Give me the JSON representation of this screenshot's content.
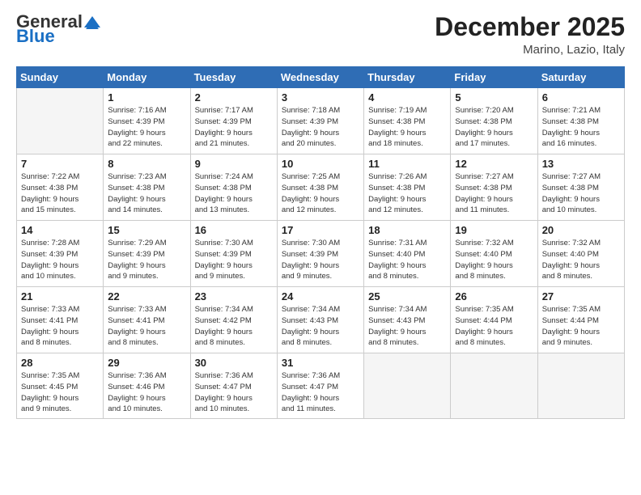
{
  "logo": {
    "general": "General",
    "blue": "Blue"
  },
  "header": {
    "month": "December 2025",
    "location": "Marino, Lazio, Italy"
  },
  "weekdays": [
    "Sunday",
    "Monday",
    "Tuesday",
    "Wednesday",
    "Thursday",
    "Friday",
    "Saturday"
  ],
  "weeks": [
    [
      {
        "day": "",
        "info": ""
      },
      {
        "day": "1",
        "info": "Sunrise: 7:16 AM\nSunset: 4:39 PM\nDaylight: 9 hours\nand 22 minutes."
      },
      {
        "day": "2",
        "info": "Sunrise: 7:17 AM\nSunset: 4:39 PM\nDaylight: 9 hours\nand 21 minutes."
      },
      {
        "day": "3",
        "info": "Sunrise: 7:18 AM\nSunset: 4:39 PM\nDaylight: 9 hours\nand 20 minutes."
      },
      {
        "day": "4",
        "info": "Sunrise: 7:19 AM\nSunset: 4:38 PM\nDaylight: 9 hours\nand 18 minutes."
      },
      {
        "day": "5",
        "info": "Sunrise: 7:20 AM\nSunset: 4:38 PM\nDaylight: 9 hours\nand 17 minutes."
      },
      {
        "day": "6",
        "info": "Sunrise: 7:21 AM\nSunset: 4:38 PM\nDaylight: 9 hours\nand 16 minutes."
      }
    ],
    [
      {
        "day": "7",
        "info": "Sunrise: 7:22 AM\nSunset: 4:38 PM\nDaylight: 9 hours\nand 15 minutes."
      },
      {
        "day": "8",
        "info": "Sunrise: 7:23 AM\nSunset: 4:38 PM\nDaylight: 9 hours\nand 14 minutes."
      },
      {
        "day": "9",
        "info": "Sunrise: 7:24 AM\nSunset: 4:38 PM\nDaylight: 9 hours\nand 13 minutes."
      },
      {
        "day": "10",
        "info": "Sunrise: 7:25 AM\nSunset: 4:38 PM\nDaylight: 9 hours\nand 12 minutes."
      },
      {
        "day": "11",
        "info": "Sunrise: 7:26 AM\nSunset: 4:38 PM\nDaylight: 9 hours\nand 12 minutes."
      },
      {
        "day": "12",
        "info": "Sunrise: 7:27 AM\nSunset: 4:38 PM\nDaylight: 9 hours\nand 11 minutes."
      },
      {
        "day": "13",
        "info": "Sunrise: 7:27 AM\nSunset: 4:38 PM\nDaylight: 9 hours\nand 10 minutes."
      }
    ],
    [
      {
        "day": "14",
        "info": "Sunrise: 7:28 AM\nSunset: 4:39 PM\nDaylight: 9 hours\nand 10 minutes."
      },
      {
        "day": "15",
        "info": "Sunrise: 7:29 AM\nSunset: 4:39 PM\nDaylight: 9 hours\nand 9 minutes."
      },
      {
        "day": "16",
        "info": "Sunrise: 7:30 AM\nSunset: 4:39 PM\nDaylight: 9 hours\nand 9 minutes."
      },
      {
        "day": "17",
        "info": "Sunrise: 7:30 AM\nSunset: 4:39 PM\nDaylight: 9 hours\nand 9 minutes."
      },
      {
        "day": "18",
        "info": "Sunrise: 7:31 AM\nSunset: 4:40 PM\nDaylight: 9 hours\nand 8 minutes."
      },
      {
        "day": "19",
        "info": "Sunrise: 7:32 AM\nSunset: 4:40 PM\nDaylight: 9 hours\nand 8 minutes."
      },
      {
        "day": "20",
        "info": "Sunrise: 7:32 AM\nSunset: 4:40 PM\nDaylight: 9 hours\nand 8 minutes."
      }
    ],
    [
      {
        "day": "21",
        "info": "Sunrise: 7:33 AM\nSunset: 4:41 PM\nDaylight: 9 hours\nand 8 minutes."
      },
      {
        "day": "22",
        "info": "Sunrise: 7:33 AM\nSunset: 4:41 PM\nDaylight: 9 hours\nand 8 minutes."
      },
      {
        "day": "23",
        "info": "Sunrise: 7:34 AM\nSunset: 4:42 PM\nDaylight: 9 hours\nand 8 minutes."
      },
      {
        "day": "24",
        "info": "Sunrise: 7:34 AM\nSunset: 4:43 PM\nDaylight: 9 hours\nand 8 minutes."
      },
      {
        "day": "25",
        "info": "Sunrise: 7:34 AM\nSunset: 4:43 PM\nDaylight: 9 hours\nand 8 minutes."
      },
      {
        "day": "26",
        "info": "Sunrise: 7:35 AM\nSunset: 4:44 PM\nDaylight: 9 hours\nand 8 minutes."
      },
      {
        "day": "27",
        "info": "Sunrise: 7:35 AM\nSunset: 4:44 PM\nDaylight: 9 hours\nand 9 minutes."
      }
    ],
    [
      {
        "day": "28",
        "info": "Sunrise: 7:35 AM\nSunset: 4:45 PM\nDaylight: 9 hours\nand 9 minutes."
      },
      {
        "day": "29",
        "info": "Sunrise: 7:36 AM\nSunset: 4:46 PM\nDaylight: 9 hours\nand 10 minutes."
      },
      {
        "day": "30",
        "info": "Sunrise: 7:36 AM\nSunset: 4:47 PM\nDaylight: 9 hours\nand 10 minutes."
      },
      {
        "day": "31",
        "info": "Sunrise: 7:36 AM\nSunset: 4:47 PM\nDaylight: 9 hours\nand 11 minutes."
      },
      {
        "day": "",
        "info": ""
      },
      {
        "day": "",
        "info": ""
      },
      {
        "day": "",
        "info": ""
      }
    ]
  ]
}
